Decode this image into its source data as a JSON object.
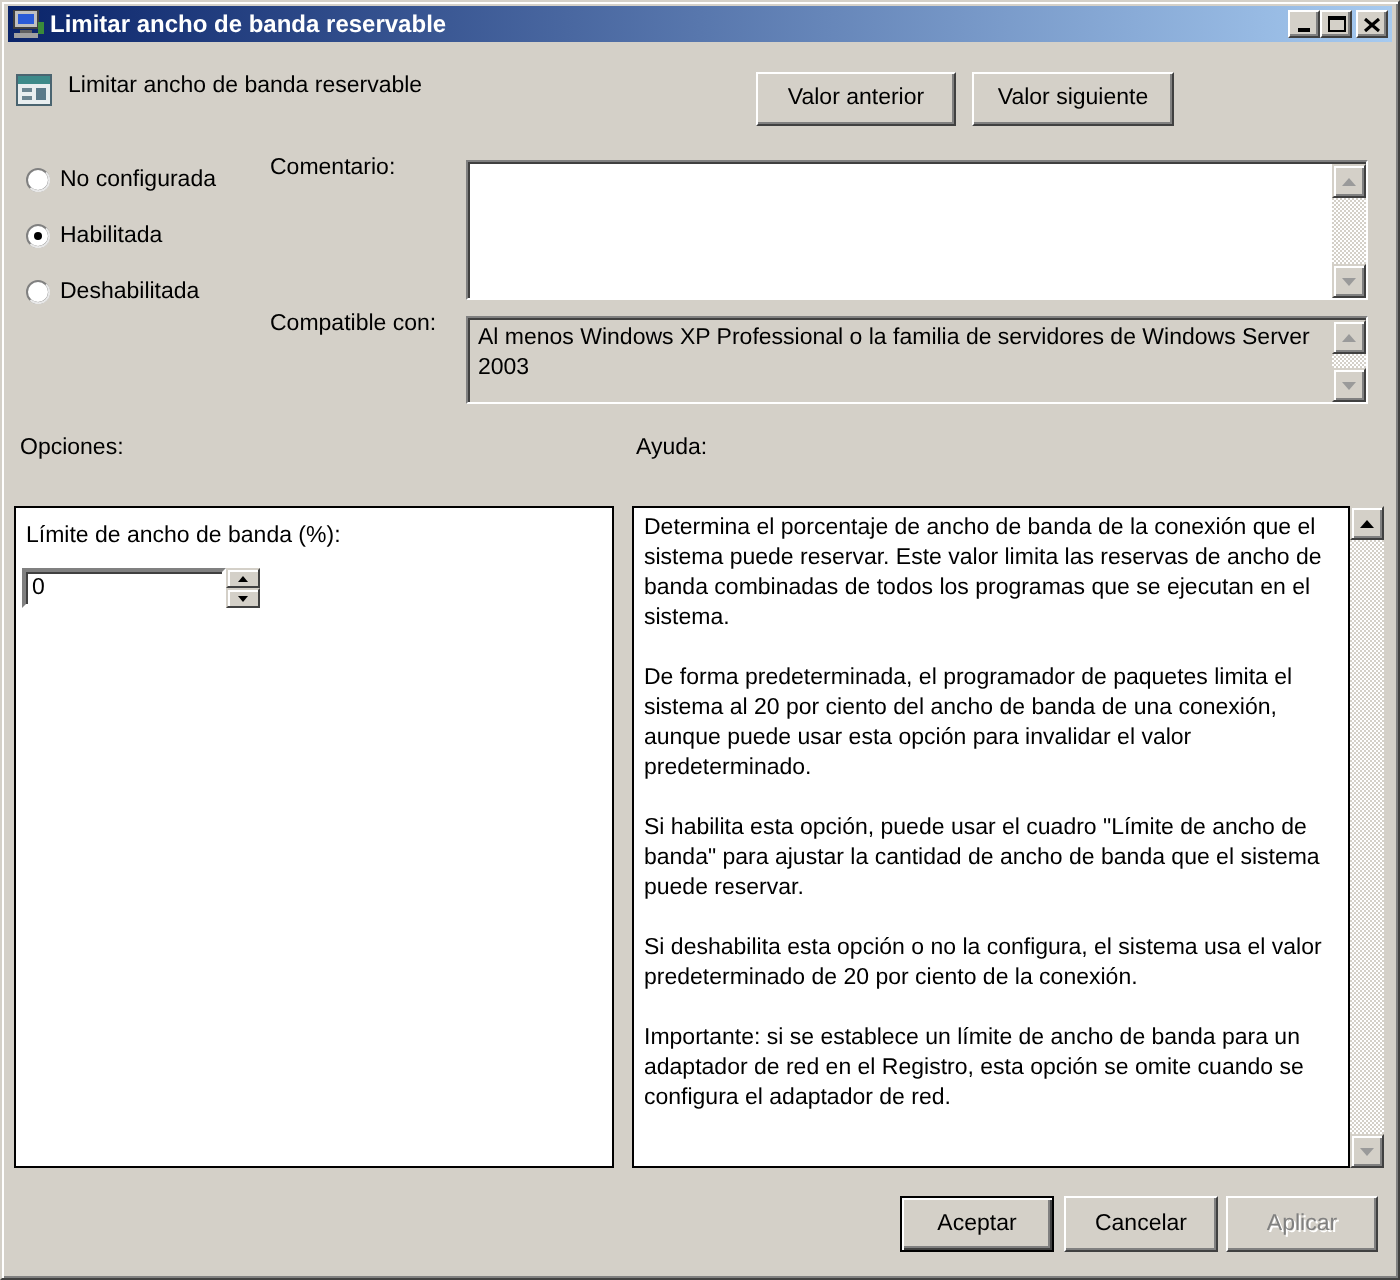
{
  "window": {
    "title": "Limitar ancho de banda reservable"
  },
  "header": {
    "policy_title": "Limitar ancho de banda reservable",
    "buttons": [
      {
        "label": "Valor anterior"
      },
      {
        "label": "Valor siguiente"
      }
    ]
  },
  "state_options": [
    {
      "label": "No configurada",
      "selected": false
    },
    {
      "label": "Habilitada",
      "selected": true
    },
    {
      "label": "Deshabilitada",
      "selected": false
    }
  ],
  "comment": {
    "label": "Comentario:"
  },
  "compatibility": {
    "label": "Compatible con:",
    "value": "Al menos Windows XP Professional o la familia de servidores de Windows Server 2003"
  },
  "options": {
    "heading": "Opciones:",
    "fields": [
      {
        "kind": "spinner",
        "label": "Límite de ancho de banda (%):",
        "value": "0"
      }
    ]
  },
  "help": {
    "heading": "Ayuda:",
    "paragraphs": [
      "Determina el porcentaje de ancho de banda de la conexión que el sistema puede reservar. Este valor limita las reservas de ancho de banda combinadas de todos los programas que se ejecutan en el sistema.",
      "De forma predeterminada, el programador de paquetes limita el sistema al 20 por ciento del ancho de banda de una conexión, aunque puede usar esta opción para invalidar el valor predeterminado.",
      "Si habilita esta opción, puede usar el cuadro \"Límite de ancho de banda\" para ajustar la cantidad de ancho de banda que el sistema puede reservar.",
      "Si deshabilita esta opción o no la configura, el sistema usa el valor predeterminado de 20 por ciento de la conexión.",
      "Importante: si se establece un límite de ancho de banda para un adaptador de red en el Registro, esta opción se omite cuando se configura el adaptador de red."
    ]
  },
  "footer": {
    "buttons": [
      {
        "label": "Aceptar",
        "default": true,
        "disabled": false
      },
      {
        "label": "Cancelar",
        "default": false,
        "disabled": false
      },
      {
        "label": "Aplicar",
        "default": false,
        "disabled": true
      }
    ]
  }
}
